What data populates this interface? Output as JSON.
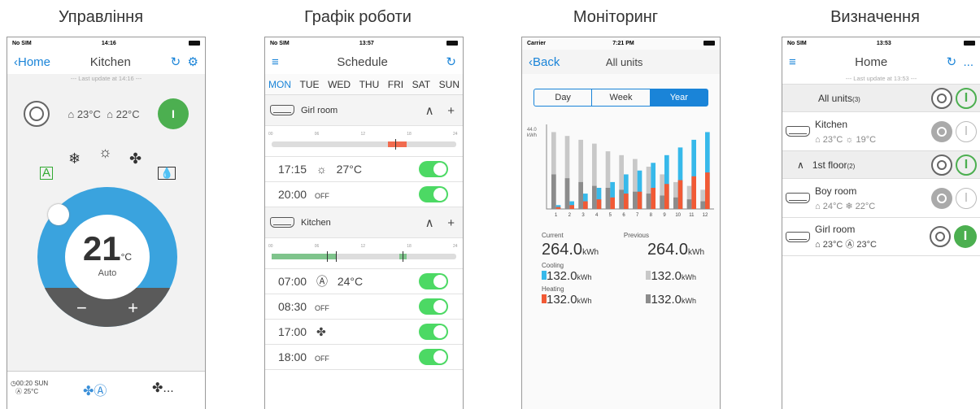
{
  "captions": [
    "Управління",
    "Графік роботи",
    "Моніторинг",
    "Визначення"
  ],
  "control": {
    "status": {
      "carrier": "No SIM",
      "time": "14:16"
    },
    "back": "Home",
    "title": "Kitchen",
    "last_update": "--- Last update at 14:16 ---",
    "indoor_temp": "23°C",
    "outdoor_temp": "22°C",
    "setpoint": "21",
    "unit": "°C",
    "mode": "Auto",
    "minus": "−",
    "plus": "+",
    "timer": "00:20 SUN",
    "timer_temp": "25°C",
    "more": "..."
  },
  "schedule": {
    "status": {
      "carrier": "No SIM",
      "time": "13:57"
    },
    "title": "Schedule",
    "days": [
      "MON",
      "TUE",
      "WED",
      "THU",
      "FRI",
      "SAT",
      "SUN"
    ],
    "ticks": [
      "00",
      "06",
      "12",
      "18",
      "24"
    ],
    "groups": [
      {
        "room": "Girl room",
        "entries": [
          {
            "time": "17:15",
            "temp": "27°C"
          },
          {
            "time": "20:00",
            "label": "OFF"
          }
        ]
      },
      {
        "room": "Kitchen",
        "entries": [
          {
            "time": "07:00",
            "temp": "24°C"
          },
          {
            "time": "08:30",
            "label": "OFF"
          },
          {
            "time": "17:00"
          },
          {
            "time": "18:00",
            "label": "OFF"
          }
        ]
      }
    ],
    "colors": {
      "red": "#f16b4f",
      "green": "#7fc48c"
    }
  },
  "monitor": {
    "status": {
      "carrier": "Carrier",
      "time": "7:21 PM"
    },
    "back": "Back",
    "title": "All units",
    "tabs": [
      "Day",
      "Week",
      "Year"
    ],
    "active_tab": "Year",
    "current_label": "Current",
    "previous_label": "Previous",
    "current": "264.0",
    "previous": "264.0",
    "unit": "kWh",
    "cooling_label": "Cooling",
    "heating_label": "Heating",
    "cooling_cur": "132.0",
    "cooling_prev": "132.0",
    "heating_cur": "132.0",
    "heating_prev": "132.0"
  },
  "chart_data": {
    "type": "bar",
    "categories": [
      "1",
      "2",
      "3",
      "4",
      "5",
      "6",
      "7",
      "8",
      "9",
      "10",
      "11",
      "12"
    ],
    "ylabel": "44.0\nkWh",
    "ylim": [
      0,
      44
    ],
    "series": [
      {
        "values": [
          40,
          38,
          36,
          34,
          30,
          28,
          26,
          22,
          18,
          14,
          12,
          10
        ]
      },
      {
        "values": [
          18,
          16,
          14,
          12,
          11,
          10,
          9,
          8,
          7,
          6,
          5,
          4
        ]
      },
      {
        "values": [
          2,
          4,
          8,
          11,
          14,
          18,
          20,
          24,
          28,
          32,
          36,
          40
        ]
      },
      {
        "values": [
          1,
          2,
          4,
          5,
          6,
          8,
          9,
          11,
          13,
          15,
          17,
          19
        ]
      }
    ],
    "colors": [
      "#c8c8c8",
      "#8c8c8c",
      "#37b9ea",
      "#f15a35"
    ]
  },
  "definition": {
    "status": {
      "carrier": "No SIM",
      "time": "13:53"
    },
    "title": "Home",
    "last_update": "--- Last update at 13:53 ---",
    "all_units": "All units",
    "all_count": "(3)",
    "kitchen": {
      "name": "Kitchen",
      "t1": "23°C",
      "t2": "19°C"
    },
    "floor": "1st floor",
    "floor_count": "(2)",
    "boy": {
      "name": "Boy room",
      "t1": "24°C",
      "t2": "22°C"
    },
    "girl": {
      "name": "Girl room",
      "t1": "23°C",
      "t2": "23°C"
    },
    "more": "..."
  }
}
